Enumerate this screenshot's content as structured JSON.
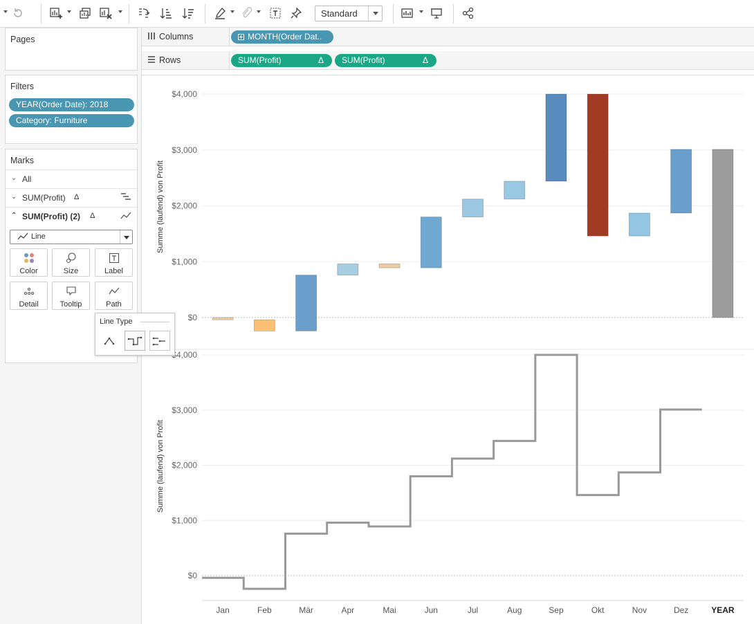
{
  "toolbar": {
    "view_mode": "Standard",
    "icons": [
      "undo-icon",
      "redo-icon",
      "new-worksheet-icon",
      "duplicate-sheet-icon",
      "clear-sheet-icon",
      "swap-axes-icon",
      "sort-ascending-icon",
      "sort-descending-icon",
      "highlight-icon",
      "group-icon",
      "show-labels-icon",
      "pin-icon",
      "show-me-icon",
      "presentation-icon",
      "share-icon"
    ]
  },
  "pages": {
    "title": "Pages"
  },
  "filters": {
    "title": "Filters",
    "items": [
      "YEAR(Order Date): 2018",
      "Category: Furniture"
    ]
  },
  "marks": {
    "title": "Marks",
    "all_label": "All",
    "layer1_label": "SUM(Profit)",
    "layer2_label": "SUM(Profit) (2)",
    "delta": "Δ",
    "mark_type": "Line",
    "buttons": [
      "Color",
      "Size",
      "Label",
      "Detail",
      "Tooltip",
      "Path"
    ]
  },
  "line_type_popup": {
    "title": "Line Type",
    "selected": "step"
  },
  "shelves": {
    "columns_label": "Columns",
    "rows_label": "Rows",
    "columns_pill": "MONTH(Order Dat..",
    "rows_pills": [
      "SUM(Profit)",
      "SUM(Profit)"
    ],
    "delta": "Δ"
  },
  "colors": {
    "pill_blue": "#4996b2",
    "pill_green": "#1ba685",
    "step_line": "#999999"
  },
  "chart_data": [
    {
      "type": "bar",
      "subtype": "waterfall (gantt bars of running total)",
      "ylabel": "Summe (laufend) von Profit",
      "ylim": [
        -400,
        4000
      ],
      "yticks": [
        "$0",
        "$1,000",
        "$2,000",
        "$3,000",
        "$4,000"
      ],
      "categories": [
        "Jan",
        "Feb",
        "Mär",
        "Apr",
        "Mai",
        "Jun",
        "Jul",
        "Aug",
        "Sep",
        "Okt",
        "Nov",
        "Dez",
        "YEAR"
      ],
      "bars": [
        {
          "label": "Jan",
          "start": 0,
          "end": -40,
          "color": "#f1ce9f"
        },
        {
          "label": "Feb",
          "start": -40,
          "end": -240,
          "color": "#fbbf74"
        },
        {
          "label": "Mär",
          "start": -240,
          "end": 760,
          "color": "#6a9fcb"
        },
        {
          "label": "Apr",
          "start": 760,
          "end": 960,
          "color": "#a6cde0"
        },
        {
          "label": "Mai",
          "start": 960,
          "end": 890,
          "color": "#ebcca4"
        },
        {
          "label": "Jun",
          "start": 890,
          "end": 1800,
          "color": "#6fa8d0"
        },
        {
          "label": "Jul",
          "start": 1800,
          "end": 2120,
          "color": "#9ac8e2"
        },
        {
          "label": "Aug",
          "start": 2120,
          "end": 2440,
          "color": "#99c9e2"
        },
        {
          "label": "Sep",
          "start": 2440,
          "end": 4000,
          "color": "#5a8bbe"
        },
        {
          "label": "Okt",
          "start": 4000,
          "end": 1460,
          "color": "#a13b23"
        },
        {
          "label": "Nov",
          "start": 1460,
          "end": 1870,
          "color": "#94c5e3"
        },
        {
          "label": "Dez",
          "start": 1870,
          "end": 3010,
          "color": "#6a9fcb"
        },
        {
          "label": "YEAR",
          "start": 0,
          "end": 3010,
          "color": "#9c9c9c"
        }
      ]
    },
    {
      "type": "line",
      "subtype": "step",
      "ylabel": "Summe (laufend) von Profit",
      "ylim": [
        -250,
        4000
      ],
      "yticks": [
        "$0",
        "$1,000",
        "$2,000",
        "$3,000",
        "$4,000"
      ],
      "categories": [
        "Jan",
        "Feb",
        "Mär",
        "Apr",
        "Mai",
        "Jun",
        "Jul",
        "Aug",
        "Sep",
        "Okt",
        "Nov",
        "Dez",
        "YEAR"
      ],
      "values": [
        -40,
        -240,
        760,
        960,
        890,
        1800,
        2120,
        2440,
        4000,
        1460,
        1870,
        3010
      ],
      "color": "#999999"
    }
  ]
}
